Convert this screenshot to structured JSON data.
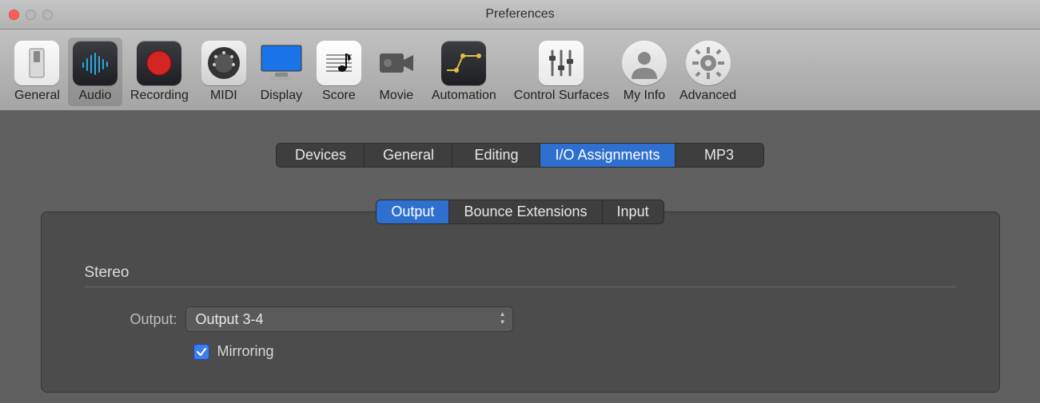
{
  "window": {
    "title": "Preferences"
  },
  "toolbar": {
    "items": [
      {
        "label": "General"
      },
      {
        "label": "Audio"
      },
      {
        "label": "Recording"
      },
      {
        "label": "MIDI"
      },
      {
        "label": "Display"
      },
      {
        "label": "Score"
      },
      {
        "label": "Movie"
      },
      {
        "label": "Automation"
      },
      {
        "label": "Control Surfaces"
      },
      {
        "label": "My Info"
      },
      {
        "label": "Advanced"
      }
    ],
    "selected_index": 1
  },
  "tabs_main": {
    "items": [
      "Devices",
      "General",
      "Editing",
      "I/O Assignments",
      "MP3"
    ],
    "selected_index": 3
  },
  "tabs_sub": {
    "items": [
      "Output",
      "Bounce Extensions",
      "Input"
    ],
    "selected_index": 0
  },
  "stereo_section": {
    "title": "Stereo",
    "output_label": "Output:",
    "output_value": "Output 3-4",
    "mirroring_label": "Mirroring",
    "mirroring_checked": true
  }
}
